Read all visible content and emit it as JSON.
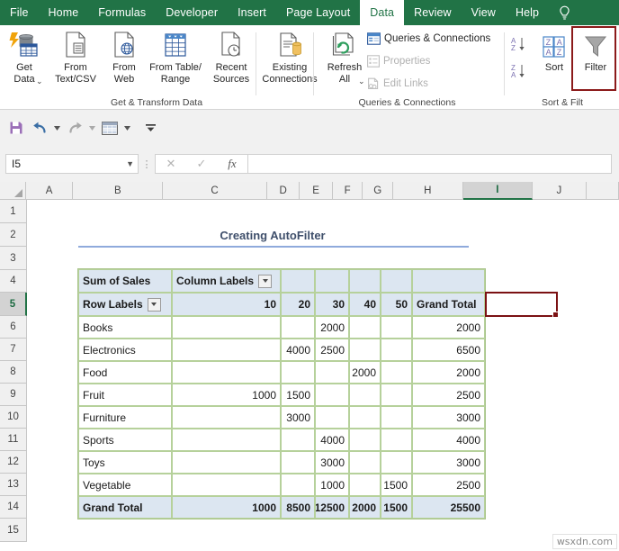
{
  "ribbon_tabs": [
    {
      "label": "File",
      "active": false
    },
    {
      "label": "Home",
      "active": false
    },
    {
      "label": "Formulas",
      "active": false
    },
    {
      "label": "Developer",
      "active": false
    },
    {
      "label": "Insert",
      "active": false
    },
    {
      "label": "Page Layout",
      "active": false
    },
    {
      "label": "Data",
      "active": true
    },
    {
      "label": "Review",
      "active": false
    },
    {
      "label": "View",
      "active": false
    },
    {
      "label": "Help",
      "active": false
    }
  ],
  "tell_me_icon": "lightbulb-icon",
  "ribbon": {
    "groups": [
      {
        "name": "Get & Transform Data",
        "label": "Get & Transform Data"
      },
      {
        "name": "Queries & Connections",
        "label": "Queries & Connections"
      },
      {
        "name": "Sort & Filter",
        "label": "Sort & Filt"
      }
    ],
    "get_transform": {
      "get_data": "Get\nData",
      "from_text_csv": "From\nText/CSV",
      "from_web": "From\nWeb",
      "from_table_range": "From Table/\nRange",
      "recent_sources": "Recent\nSources",
      "existing_connections": "Existing\nConnections"
    },
    "queries": {
      "refresh_all": "Refresh\nAll",
      "queries_connections": "Queries & Connections",
      "properties": "Properties",
      "edit_links": "Edit Links"
    },
    "sortfilter": {
      "sort_az": "sort-ascending-icon",
      "sort_za": "sort-descending-icon",
      "sort": "Sort",
      "filter": "Filter",
      "filter_highlighted": true,
      "highlight_color": "#8B1A1A"
    }
  },
  "quick_access": {
    "save": "save-icon",
    "undo": "undo-icon",
    "redo": "redo-icon",
    "table": "table-icon",
    "more": "more-options-icon"
  },
  "formula_bar": {
    "name_box_value": "I5",
    "cancel_icon": "cancel-icon",
    "enter_icon": "confirm-icon",
    "function_icon": "fx-icon",
    "formula_value": ""
  },
  "grid": {
    "columns": [
      "A",
      "B",
      "C",
      "D",
      "E",
      "F",
      "G",
      "H",
      "I",
      "J"
    ],
    "selected_column": "I",
    "rows": [
      "1",
      "2",
      "3",
      "4",
      "5",
      "6",
      "7",
      "8",
      "9",
      "10",
      "11",
      "12",
      "13",
      "14",
      "15"
    ],
    "selected_row": "5",
    "selected_cell": "I5"
  },
  "sheet": {
    "title": "Creating AutoFilter",
    "pivot": {
      "sum_of_sales": "Sum of Sales",
      "column_labels": "Column Labels",
      "row_labels": "Row Labels",
      "grand_total_header": "Grand Total",
      "column_headers": [
        "10",
        "20",
        "30",
        "40",
        "50"
      ],
      "rows": [
        {
          "label": "Books",
          "values": [
            "",
            "",
            "2000",
            "",
            ""
          ],
          "total": "2000"
        },
        {
          "label": "Electronics",
          "values": [
            "",
            "4000",
            "2500",
            "",
            ""
          ],
          "total": "6500"
        },
        {
          "label": "Food",
          "values": [
            "",
            "",
            "",
            "2000",
            ""
          ],
          "total": "2000"
        },
        {
          "label": "Fruit",
          "values": [
            "1000",
            "1500",
            "",
            "",
            ""
          ],
          "total": "2500"
        },
        {
          "label": "Furniture",
          "values": [
            "",
            "3000",
            "",
            "",
            ""
          ],
          "total": "3000"
        },
        {
          "label": "Sports",
          "values": [
            "",
            "",
            "4000",
            "",
            ""
          ],
          "total": "4000"
        },
        {
          "label": "Toys",
          "values": [
            "",
            "",
            "3000",
            "",
            ""
          ],
          "total": "3000"
        },
        {
          "label": "Vegetable",
          "values": [
            "",
            "",
            "1000",
            "",
            "1500"
          ],
          "total": "2500"
        }
      ],
      "grand_total_row": {
        "label": "Grand Total",
        "values": [
          "1000",
          "8500",
          "12500",
          "2000",
          "1500"
        ],
        "total": "25500"
      }
    }
  },
  "watermark": "wsxdn.com"
}
